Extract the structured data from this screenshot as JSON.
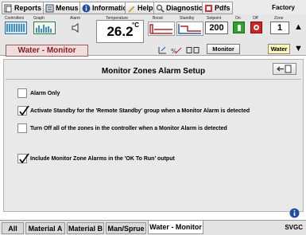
{
  "menubar": {
    "reports": "Reports",
    "menus": "Menus",
    "information": "Information",
    "help": "Help",
    "diagnostics": "Diagnostics",
    "pdfs": "Pdfs",
    "factory": "Factory"
  },
  "controls": {
    "controllers_label": "Controllers",
    "graph_label": "Graph",
    "alarm_label": "Alarm",
    "temperature_label": "Temperature",
    "temperature_value": "26.2",
    "temperature_unit": "°C",
    "boost_label": "Boost",
    "standby_label": "Standby",
    "setpoint_label": "Setpoint",
    "setpoint_value": "200",
    "on_label": "On",
    "off_label": "Off",
    "zone_label": "Zone",
    "zone_value": "1",
    "zone_name": "Water - Monitor",
    "monitor_button": "Monitor",
    "water_button": "Water"
  },
  "panel": {
    "title": "Monitor Zones Alarm Setup",
    "options": [
      {
        "label": "Alarm Only",
        "checked": false
      },
      {
        "label": "Activate Standby for the 'Remote Standby' group when a Monitor Alarm is detected",
        "checked": true
      },
      {
        "label": "Turn Off all of the zones in the controller when a Monitor Alarm is detected",
        "checked": false
      },
      {
        "label": "Include Monitor Zone Alarms in the 'OK To Run' output",
        "checked": true
      }
    ]
  },
  "tabs": [
    {
      "label": "All",
      "active": false
    },
    {
      "label": "Material A",
      "active": false
    },
    {
      "label": "Material B",
      "active": false
    },
    {
      "label": "Man/Sprue",
      "active": false
    },
    {
      "label": "Water - Monitor",
      "active": true
    }
  ],
  "footer_code": "SVGC",
  "colors": {
    "zone_name_text": "#8a1b1b",
    "on_green": "#2aa52a",
    "off_red": "#d42020",
    "water_yellow": "#fdf6b8"
  }
}
